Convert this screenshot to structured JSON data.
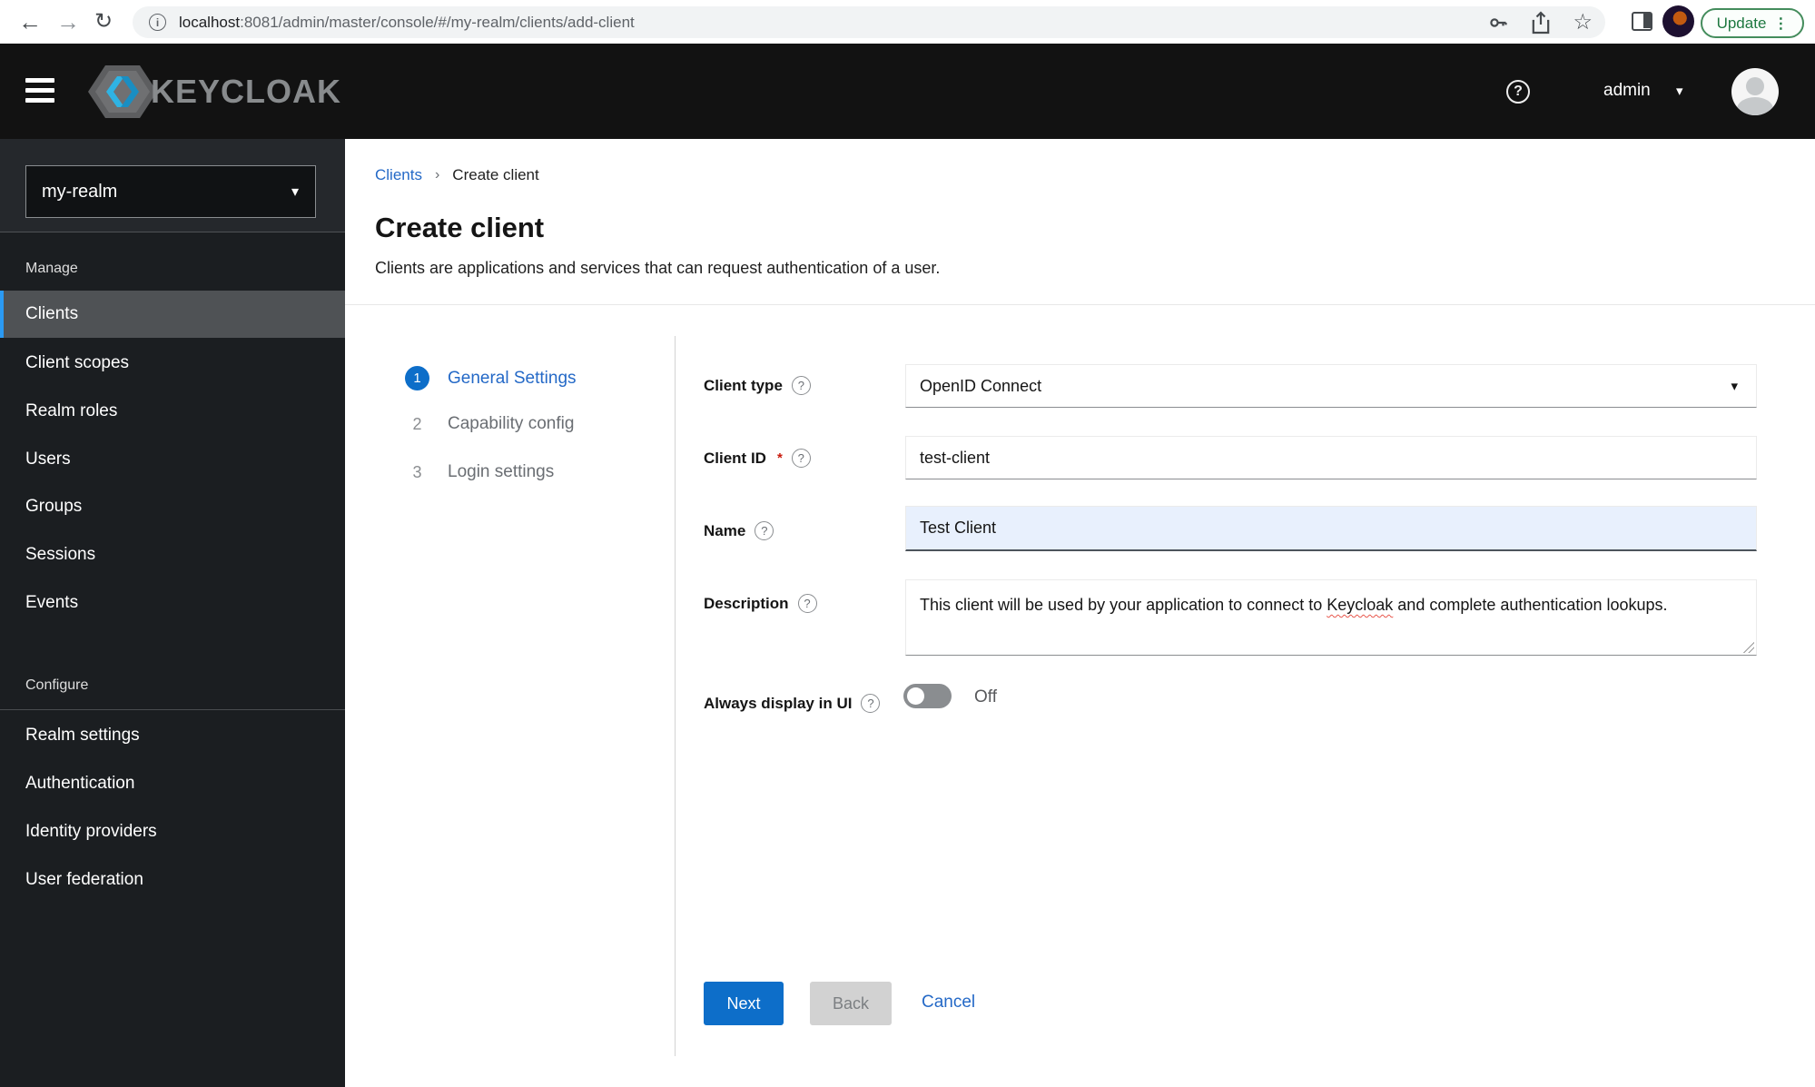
{
  "browser": {
    "url_host": "localhost",
    "url_path": ":8081/admin/master/console/#/my-realm/clients/add-client",
    "update_label": "Update",
    "update_dots": "⋮"
  },
  "header": {
    "brand": "KEYCLOAK",
    "help": "?",
    "user": "admin",
    "caret": "▾"
  },
  "sidebar": {
    "realm": "my-realm",
    "realm_caret": "▾",
    "manage": {
      "label": "Manage",
      "items": [
        "Clients",
        "Client scopes",
        "Realm roles",
        "Users",
        "Groups",
        "Sessions",
        "Events"
      ]
    },
    "configure": {
      "label": "Configure",
      "items": [
        "Realm settings",
        "Authentication",
        "Identity providers",
        "User federation"
      ]
    }
  },
  "breadcrumb": {
    "parent": "Clients",
    "separator": "›",
    "current": "Create client"
  },
  "page": {
    "title": "Create client",
    "subtitle": "Clients are applications and services that can request authentication of a user."
  },
  "wizard": {
    "steps": [
      {
        "num": "1",
        "label": "General Settings"
      },
      {
        "num": "2",
        "label": "Capability config"
      },
      {
        "num": "3",
        "label": "Login settings"
      }
    ]
  },
  "form": {
    "client_type": {
      "label": "Client type",
      "help": "?",
      "value": "OpenID Connect",
      "caret": "▾"
    },
    "client_id": {
      "label": "Client ID",
      "required": "*",
      "help": "?",
      "value": "test-client"
    },
    "name": {
      "label": "Name",
      "help": "?",
      "value": "Test Client"
    },
    "description": {
      "label": "Description",
      "help": "?",
      "value_before": "This client will be used by your application to connect to ",
      "value_flagged": "Keycloak",
      "value_after": " and complete authentication lookups."
    },
    "always_display": {
      "label": "Always display in UI",
      "help": "?",
      "state": "Off"
    }
  },
  "actions": {
    "next": "Next",
    "back": "Back",
    "cancel": "Cancel"
  },
  "colors": {
    "accent_blue": "#0d6ec9",
    "link_blue": "#2469c7",
    "header_bg": "#121212",
    "sidebar_bg": "#1b1e21",
    "sidebar_active": "#4f5255",
    "sidebar_active_border": "#2b9af3",
    "update_green": "#1e7840",
    "required_red": "#c9190b",
    "autofill_bg": "#e8f0fd"
  }
}
